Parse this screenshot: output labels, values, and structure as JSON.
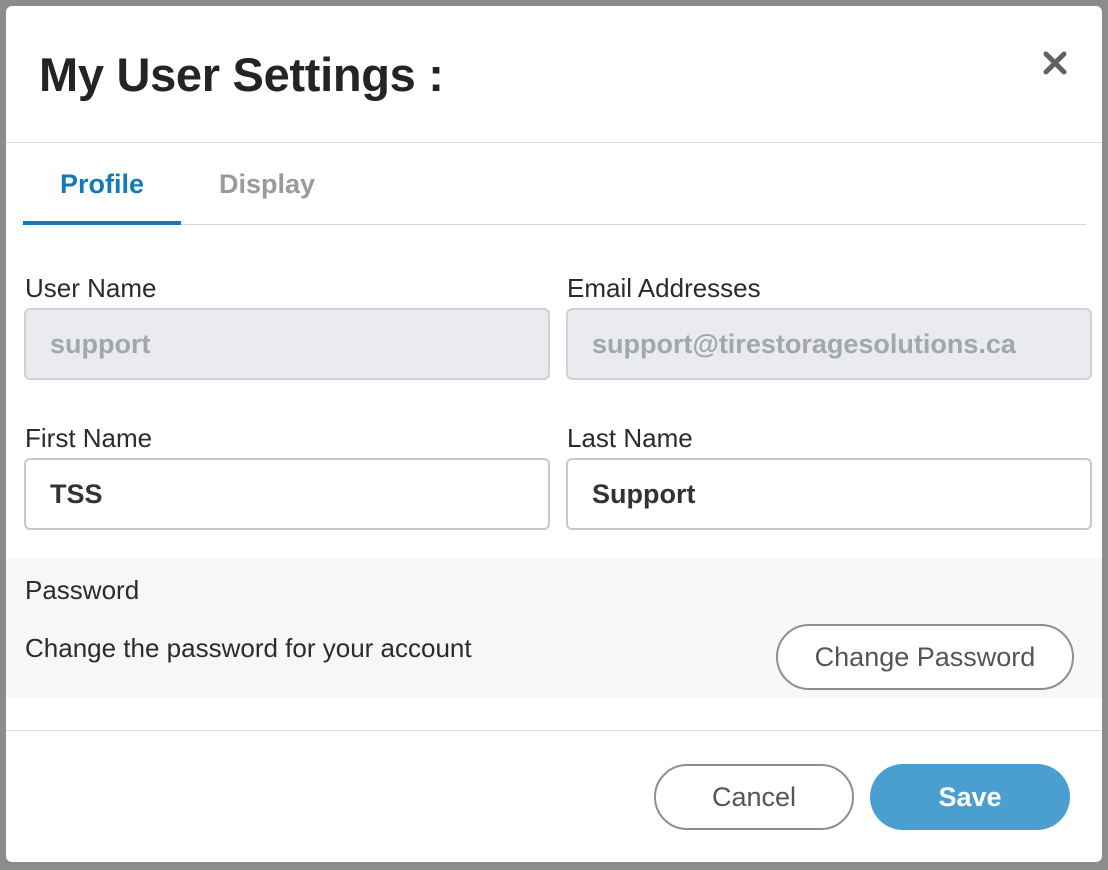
{
  "dialog": {
    "title": "My User Settings :"
  },
  "tabs": [
    {
      "label": "Profile",
      "active": true
    },
    {
      "label": "Display",
      "active": false
    }
  ],
  "profile": {
    "user_name_label": "User Name",
    "user_name_value": "support",
    "email_label": "Email Addresses",
    "email_value": "support@tirestoragesolutions.ca",
    "first_name_label": "First Name",
    "first_name_value": "TSS",
    "last_name_label": "Last Name",
    "last_name_value": "Support"
  },
  "password": {
    "title": "Password",
    "description": "Change the password for your account",
    "change_button_label": "Change Password"
  },
  "footer": {
    "cancel_label": "Cancel",
    "save_label": "Save"
  },
  "colors": {
    "accent": "#1479b8",
    "save_button": "#4a9fd0",
    "disabled_field_bg": "#e9ebee",
    "password_section_bg": "#f6f7f9"
  },
  "icons": {
    "close": "close-icon"
  }
}
